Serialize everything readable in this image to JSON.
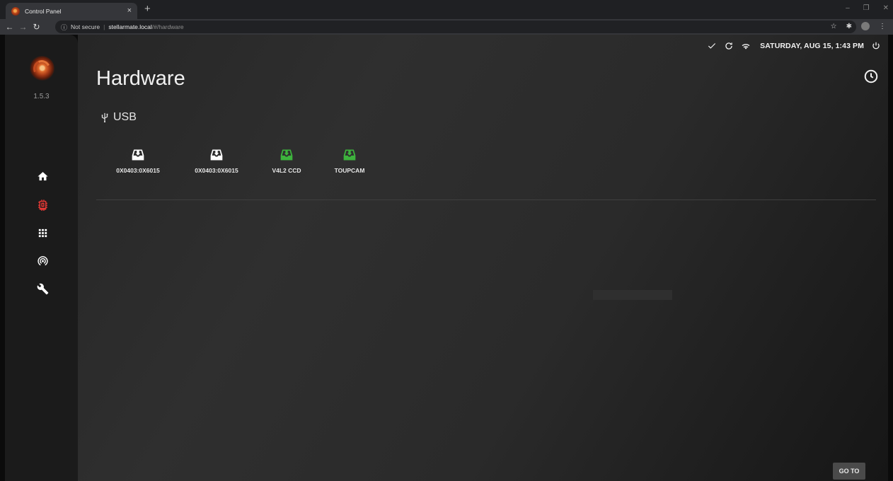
{
  "browser": {
    "tab_title": "Control Panel",
    "tab_close": "×",
    "new_tab": "+",
    "address": {
      "security": "Not secure",
      "host": "stellarmate.local",
      "path": "/#/hardware"
    }
  },
  "sidebar": {
    "version": "1.5.3",
    "items": [
      {
        "name": "home-icon",
        "active": false
      },
      {
        "name": "chip-icon",
        "active": true
      },
      {
        "name": "apps-grid-icon",
        "active": false
      },
      {
        "name": "broadcast-icon",
        "active": false
      },
      {
        "name": "wrench-icon",
        "active": false
      }
    ],
    "active_color": "#e53935"
  },
  "status": {
    "datetime": "SATURDAY, AUG 15, 1:43 PM"
  },
  "page": {
    "title": "Hardware",
    "section": "USB"
  },
  "devices": [
    {
      "label": "0X0403:0X6015",
      "color": "#ffffff",
      "icon": "usb-drive-icon"
    },
    {
      "label": "0X0403:0X6015",
      "color": "#ffffff",
      "icon": "usb-drive-icon"
    },
    {
      "label": "V4L2 CCD",
      "color": "#3db33d",
      "icon": "usb-drive-icon"
    },
    {
      "label": "TOUPCAM",
      "color": "#3db33d",
      "icon": "usb-drive-icon"
    }
  ],
  "footer": {
    "goto_label": "GO TO"
  }
}
